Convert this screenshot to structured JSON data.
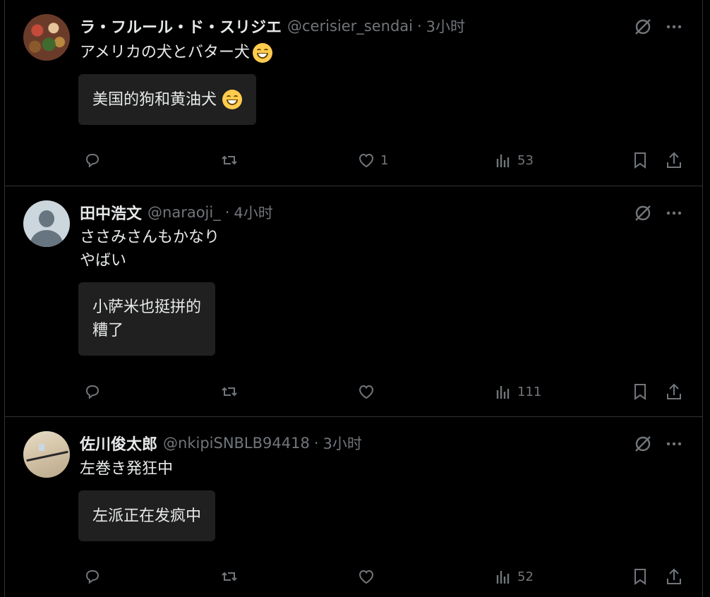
{
  "posts": [
    {
      "name": "ラ・フルール・ド・スリジエ",
      "handle": "@cerisier_sendai",
      "separator": "·",
      "time": "3小时",
      "text": "アメリカの犬とバター犬",
      "translation": "美国的狗和黄油犬",
      "replies": "",
      "reposts": "",
      "likes": "1",
      "views": "53",
      "avatar": "food-photo"
    },
    {
      "name": "田中浩文",
      "handle": "@naraoji_",
      "separator": "·",
      "time": "4小时",
      "text": "ささみさんもかなり\nやばい",
      "translation": "小萨米也挺拼的\n糟了",
      "replies": "",
      "reposts": "",
      "likes": "",
      "views": "111",
      "avatar": "default-silhouette"
    },
    {
      "name": "佐川俊太郎",
      "handle": "@nkipiSNBLB94418",
      "separator": "·",
      "time": "3小时",
      "text": "左巻き発狂中",
      "translation": "左派正在发疯中",
      "replies": "",
      "reposts": "",
      "likes": "",
      "views": "52",
      "avatar": "sword-photo"
    }
  ],
  "icons": {
    "grok": "grok-icon",
    "more": "more-icon",
    "reply": "reply-icon",
    "repost": "repost-icon",
    "like": "heart-icon",
    "views": "views-icon",
    "bookmark": "bookmark-icon",
    "share": "share-icon",
    "emoji": "grinning-emoji"
  },
  "colors": {
    "background": "#000000",
    "text": "#e7e9ea",
    "muted": "#71767b",
    "border": "#2f3336",
    "translation_bg": "#202020"
  }
}
